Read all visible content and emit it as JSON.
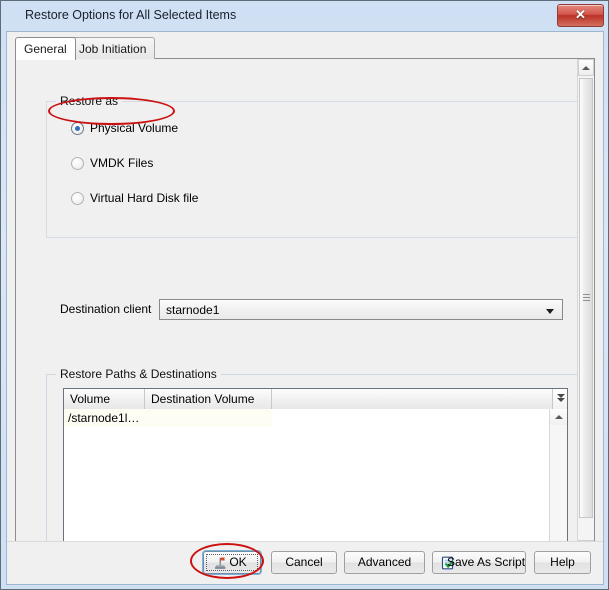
{
  "window": {
    "title": "Restore Options for All Selected Items",
    "close_label": "✕",
    "close_icon": "close-icon"
  },
  "tabs": [
    {
      "label": "General",
      "active": true
    },
    {
      "label": "Job Initiation",
      "active": false
    }
  ],
  "restore_as": {
    "group_title": "Restore as",
    "options": [
      {
        "label": "Physical Volume",
        "selected": true
      },
      {
        "label": "VMDK Files",
        "selected": false
      },
      {
        "label": "Virtual Hard Disk file",
        "selected": false
      }
    ]
  },
  "destination_client": {
    "label": "Destination client",
    "value": "starnode1",
    "arrow_icon": "chevron-down-icon"
  },
  "restore_paths": {
    "group_title": "Restore Paths & Destinations",
    "columns": [
      "Volume",
      "Destination Volume"
    ],
    "header_menu_icon": "double-chevron-down-icon",
    "rows": [
      {
        "volume": "/starnode1l…",
        "destination_volume": ""
      }
    ]
  },
  "scrollbars": {
    "panel_up_icon": "scroll-up-arrow-icon",
    "panel_down_icon": "scroll-down-arrow-icon",
    "table_up_icon": "scroll-up-arrow-icon"
  },
  "footer": {
    "buttons": [
      {
        "label": "OK",
        "icon": "stamp-icon",
        "focused": true
      },
      {
        "label": "Cancel",
        "icon": "",
        "focused": false
      },
      {
        "label": "Advanced",
        "icon": "",
        "focused": false
      },
      {
        "label": "Save As Script",
        "icon": "script-check-icon",
        "focused": false
      },
      {
        "label": "Help",
        "icon": "",
        "focused": false
      }
    ]
  },
  "annotations": {
    "highlight_color": "#cc1111",
    "targets": [
      "physical-volume-radio",
      "ok-button"
    ]
  }
}
